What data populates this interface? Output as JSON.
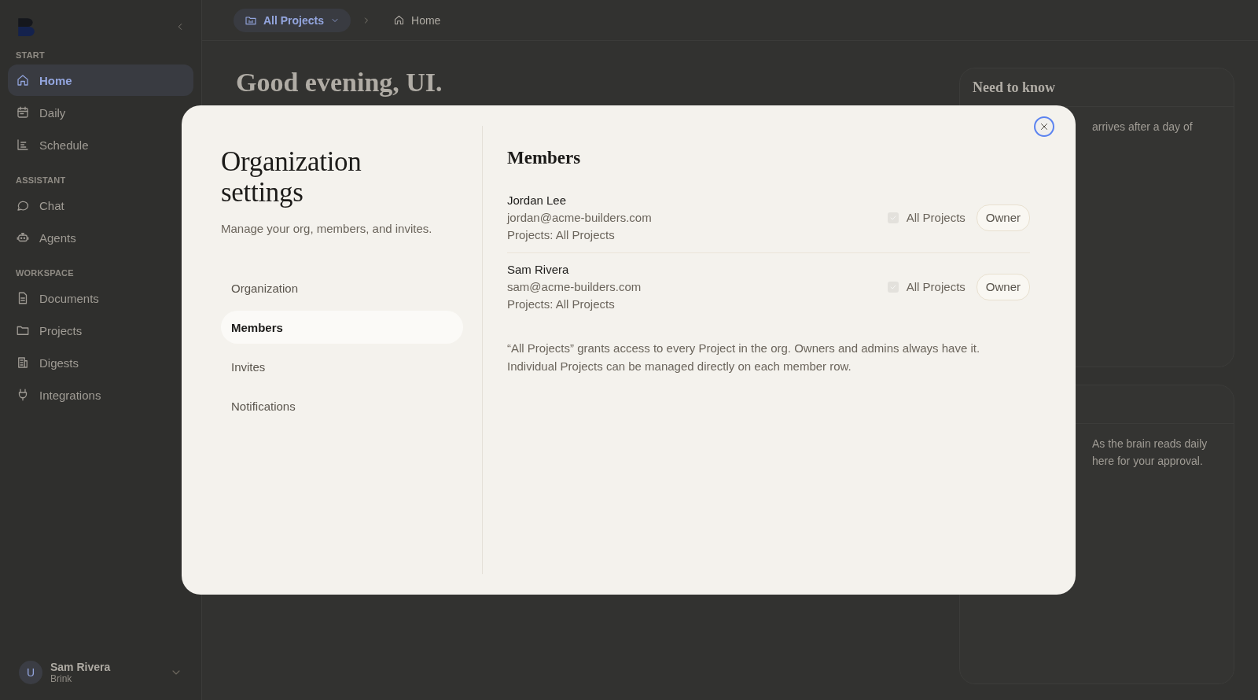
{
  "sidebar": {
    "sections": [
      {
        "label": "START",
        "items": [
          {
            "label": "Home",
            "selected": true
          },
          {
            "label": "Daily",
            "selected": false
          },
          {
            "label": "Schedule",
            "selected": false
          }
        ]
      },
      {
        "label": "ASSISTANT",
        "items": [
          {
            "label": "Chat",
            "selected": false
          },
          {
            "label": "Agents",
            "selected": false
          }
        ]
      },
      {
        "label": "WORKSPACE",
        "items": [
          {
            "label": "Documents",
            "selected": false
          },
          {
            "label": "Projects",
            "selected": false
          },
          {
            "label": "Digests",
            "selected": false
          },
          {
            "label": "Integrations",
            "selected": false
          }
        ]
      }
    ],
    "user": {
      "initial": "U",
      "name": "Sam Rivera",
      "org": "Brink"
    }
  },
  "breadcrumb": {
    "project": "All Projects",
    "page": "Home"
  },
  "main": {
    "greeting": "Good evening, UI.",
    "cards": [
      {
        "title": "Need to know",
        "lines": [
          "arrives after a day of"
        ]
      },
      {
        "lines": [
          "As the brain reads daily",
          "here for your approval."
        ]
      }
    ]
  },
  "modal": {
    "title": "Organization settings",
    "subtitle": "Manage your org, members, and invites.",
    "nav": [
      {
        "label": "Organization",
        "selected": false
      },
      {
        "label": "Members",
        "selected": true
      },
      {
        "label": "Invites",
        "selected": false
      },
      {
        "label": "Notifications",
        "selected": false
      }
    ],
    "section_title": "Members",
    "members": [
      {
        "name": "Jordan Lee",
        "email": "jordan@acme-builders.com",
        "projects": "Projects: All Projects",
        "access": {
          "label": "All Projects",
          "checked": true,
          "disabled": true
        },
        "role": "Owner"
      },
      {
        "name": "Sam Rivera",
        "email": "sam@acme-builders.com",
        "projects": "Projects: All Projects",
        "access": {
          "label": "All Projects",
          "checked": true,
          "disabled": true
        },
        "role": "Owner"
      }
    ],
    "note": "“All Projects” grants access to every Project in the org. Owners and admins always have it. Individual Projects can be managed directly on each member row."
  }
}
